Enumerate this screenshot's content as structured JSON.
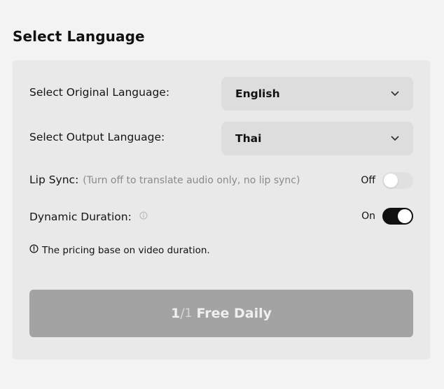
{
  "section": {
    "title": "Select Language"
  },
  "original_language": {
    "label": "Select Original Language:",
    "value": "English"
  },
  "output_language": {
    "label": "Select Output Language:",
    "value": "Thai"
  },
  "lip_sync": {
    "label": "Lip Sync:",
    "hint": "(Turn off to translate audio only, no lip sync)",
    "state_text": "Off",
    "enabled": false
  },
  "dynamic_duration": {
    "label": "Dynamic Duration:",
    "state_text": "On",
    "enabled": true
  },
  "note": {
    "text": "The pricing base on video duration."
  },
  "cta": {
    "used": "1",
    "separator": "/",
    "total": "1",
    "label": "Free Daily"
  },
  "icons": {
    "select_chevron": "chevron-down-icon",
    "info": "info-icon",
    "alert": "alert-circle-icon"
  },
  "colors": {
    "page_bg": "#f3f3f3",
    "panel_bg": "#e9e9e9",
    "select_bg": "#dddddd",
    "toggle_on": "#111111",
    "toggle_off": "#e0e0e0",
    "cta_bg": "#a3a3a3"
  }
}
